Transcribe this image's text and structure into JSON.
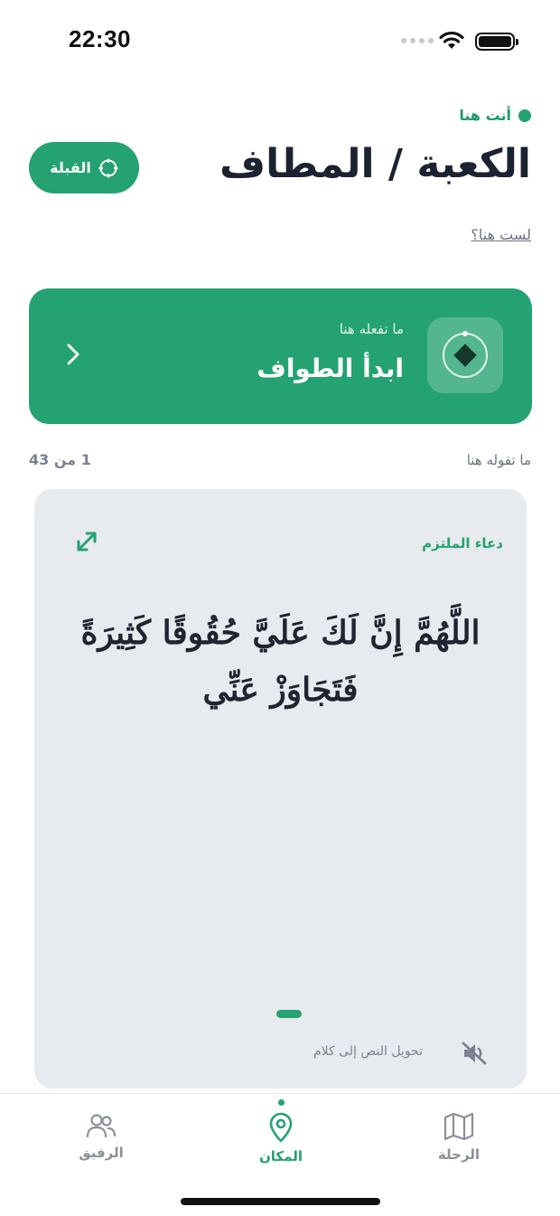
{
  "status_bar": {
    "time": "22:30"
  },
  "header": {
    "location_status": "أنت هنا",
    "title": "الكعبة / المطاف",
    "qibla_button": "القبلة",
    "not_here_link": "لست هنا؟"
  },
  "action_card": {
    "subtitle": "ما تفعله هنا",
    "title": "ابدأ الطواف"
  },
  "dua_section": {
    "label": "ما تقوله هنا",
    "counter": "1 من 43"
  },
  "dua_card": {
    "name": "دعاء الملتزم",
    "text": "اللَّهُمَّ إِنَّ لَكَ عَلَيَّ حُقُوقًا كَثِيرَةً فَتَجَاوَزْ عَنِّي",
    "tts_label": "تحويل النص إلى كلام"
  },
  "tab_bar": {
    "tabs": [
      {
        "label": "الرفيق",
        "icon": "users-icon"
      },
      {
        "label": "المكان",
        "icon": "map-pin-icon"
      },
      {
        "label": "الرحلة",
        "icon": "map-icon"
      }
    ],
    "active": "المكان"
  },
  "colors": {
    "accent": "#24a271",
    "card_bg": "#e7eaee",
    "text_dark": "#1c2230",
    "muted": "#7b8190"
  }
}
